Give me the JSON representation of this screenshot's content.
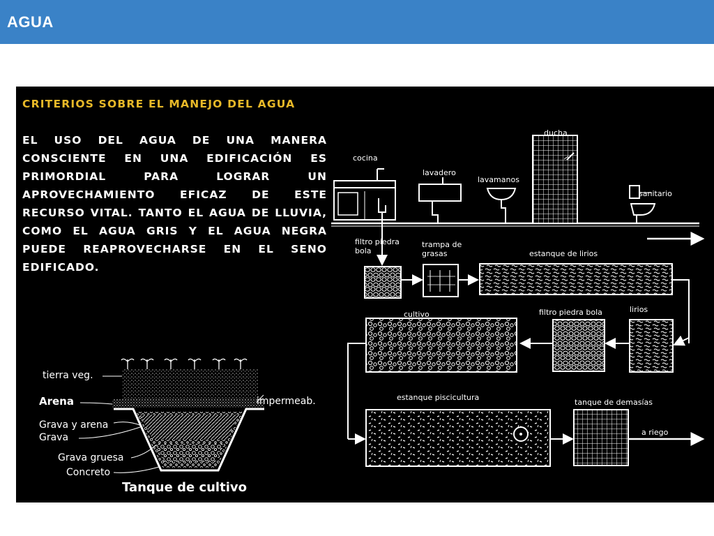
{
  "header": {
    "title": "AGUA"
  },
  "text_panel": {
    "heading": "Criterios sobre el manejo del agua",
    "body": "El uso del agua de una manera consciente en una edificación es primordial para lograr un aprovechamiento eficaz de este recurso vital. Tanto el agua de lluvia, como el agua gris y el agua negra puede reaprovecharse en el seno edificado."
  },
  "flow_diagram": {
    "fixtures": {
      "cocina": "cocina",
      "lavadero": "lavadero",
      "lavamanos": "lavamanos",
      "ducha": "ducha",
      "sanitario": "sanitario"
    },
    "row1": {
      "filtro_line1": "filtro piedra",
      "filtro_line2": "bola",
      "trampa_line1": "trampa de",
      "trampa_line2": "grasas",
      "estanque": "estanque de lirios"
    },
    "row2": {
      "cultivo": "cultivo",
      "filtro": "filtro piedra bola",
      "lirios": "lirios"
    },
    "row3": {
      "piscicultura": "estanque piscicultura",
      "demasias": "tanque de demasías",
      "riego": "a riego"
    }
  },
  "section_diagram": {
    "tierra": "tierra veg.",
    "arena": "Arena",
    "impermeab": "impermeab.",
    "grava_arena": "Grava y arena",
    "grava": "Grava",
    "grava_gruesa": "Grava gruesa",
    "concreto": "Concreto",
    "title": "Tanque de cultivo"
  }
}
